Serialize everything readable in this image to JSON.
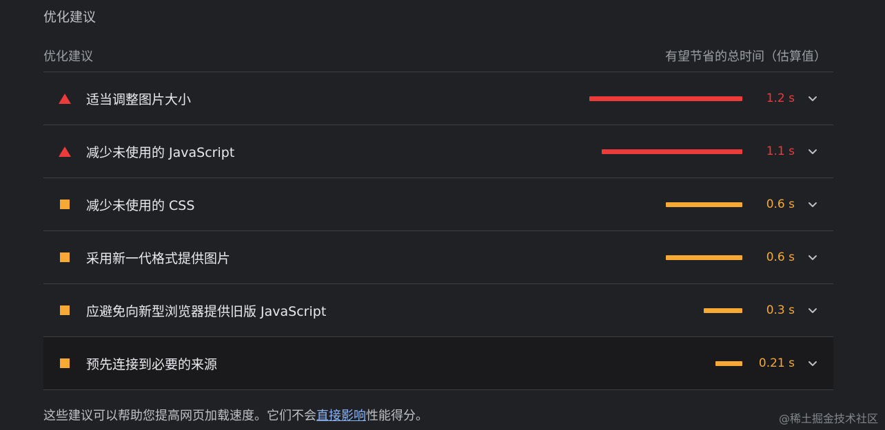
{
  "section_title": "优化建议",
  "table": {
    "col_left": "优化建议",
    "col_right": "有望节省的总时间（估算值）"
  },
  "colors": {
    "fail": "#eb3b3b",
    "average": "#f6a935"
  },
  "max_seconds": 1.2,
  "rows": [
    {
      "label": "适当调整图片大小",
      "value": "1.2 s",
      "seconds": 1.2,
      "severity": "fail",
      "icon": "triangle-warning-icon"
    },
    {
      "label": "减少未使用的 JavaScript",
      "value": "1.1 s",
      "seconds": 1.1,
      "severity": "fail",
      "icon": "triangle-warning-icon"
    },
    {
      "label": "减少未使用的 CSS",
      "value": "0.6 s",
      "seconds": 0.6,
      "severity": "average",
      "icon": "square-average-icon"
    },
    {
      "label": "采用新一代格式提供图片",
      "value": "0.6 s",
      "seconds": 0.6,
      "severity": "average",
      "icon": "square-average-icon"
    },
    {
      "label": "应避免向新型浏览器提供旧版 JavaScript",
      "value": "0.3 s",
      "seconds": 0.3,
      "severity": "average",
      "icon": "square-average-icon"
    },
    {
      "label": "预先连接到必要的来源",
      "value": "0.21 s",
      "seconds": 0.21,
      "severity": "average",
      "icon": "square-average-icon"
    }
  ],
  "footer": {
    "before": "这些建议可以帮助您提高网页加载速度。它们不会",
    "link": "直接影响",
    "after": "性能得分。"
  },
  "watermark": "@稀土掘金技术社区"
}
